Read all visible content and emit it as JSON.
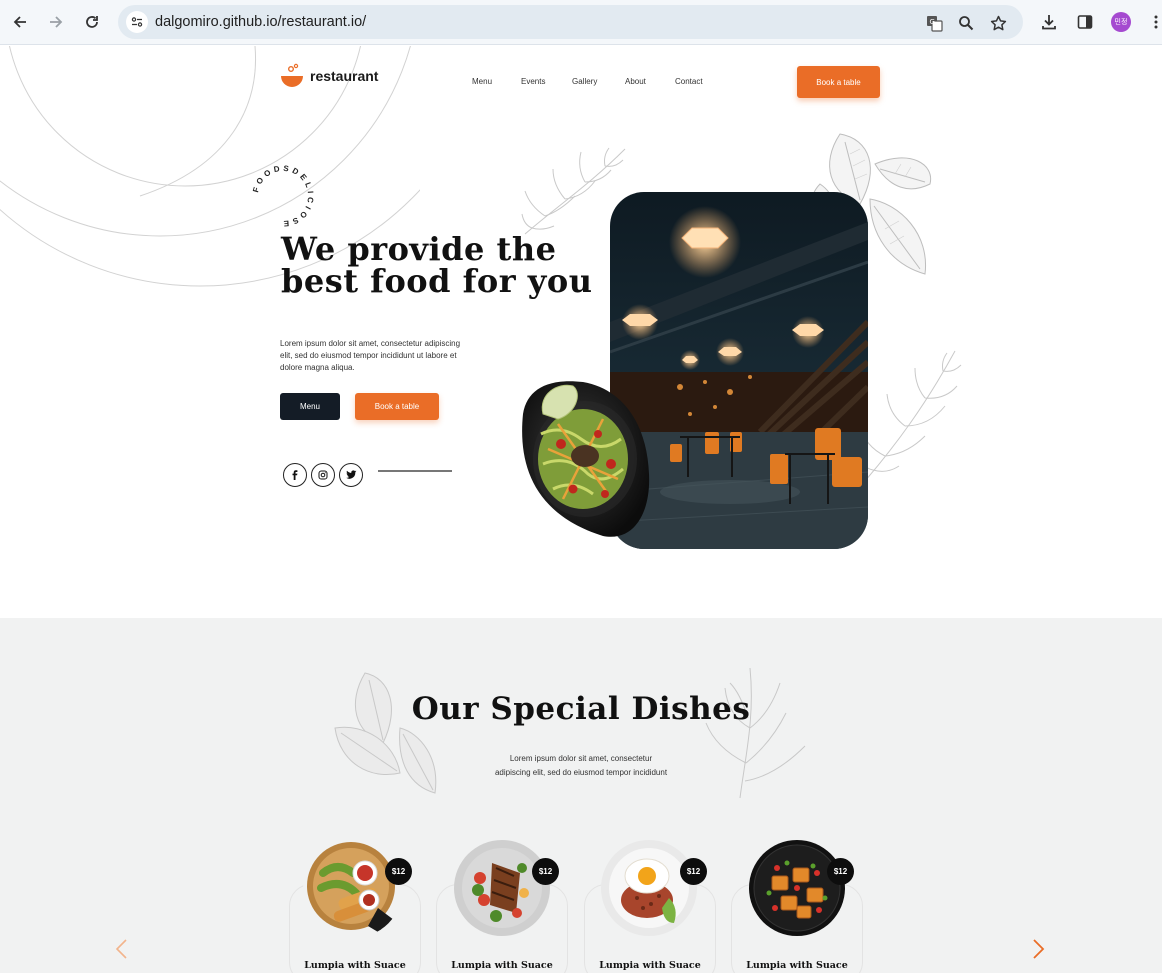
{
  "browser": {
    "url": "dalgomiro.github.io/restaurant.io/",
    "profile_initials": "민정"
  },
  "nav": {
    "logo_text": "restaurant",
    "items": [
      "Menu",
      "Events",
      "Gallery",
      "About",
      "Contact"
    ],
    "book_label": "Book a table"
  },
  "hero": {
    "ring_text": "FOODSDELICIOSE",
    "title_line1": "We provide the",
    "title_line2": "best food for you",
    "desc": "Lorem ipsum dolor sit amet, consectetur adipiscing elit, sed do eiusmod tempor incididunt ut labore et dolore magna aliqua.",
    "menu_button": "Menu",
    "book_button": "Book a table",
    "socials": [
      "facebook-icon",
      "instagram-icon",
      "twitter-icon"
    ]
  },
  "specials": {
    "title": "Our Special Dishes",
    "desc_line1": "Lorem ipsum dolor sit amet, consectetur",
    "desc_line2": "adipiscing elit, sed do eiusmod tempor incididunt",
    "dishes": [
      {
        "name": "Lumpia with Suace",
        "price": "$12"
      },
      {
        "name": "Lumpia with Suace",
        "price": "$12"
      },
      {
        "name": "Lumpia with Suace",
        "price": "$12"
      },
      {
        "name": "Lumpia with Suace",
        "price": "$12"
      }
    ]
  },
  "colors": {
    "accent": "#ea6d27",
    "dark": "#141c26",
    "section_bg": "#f1f2f2"
  }
}
